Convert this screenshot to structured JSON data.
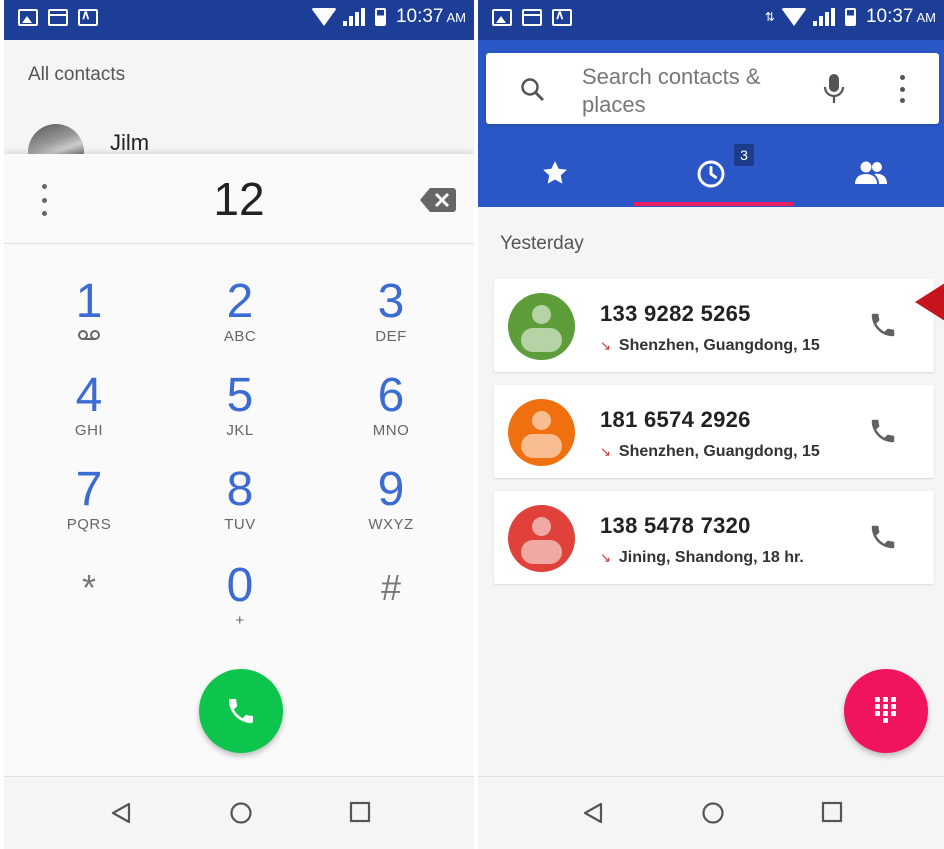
{
  "left_screen": {
    "status_bar": {
      "time": "10:37",
      "ampm": "AM"
    },
    "all_contacts_label": "All contacts",
    "contact_preview_name": "Jilm",
    "dialed_number": "12",
    "keys": [
      {
        "digit": "1",
        "letters": ""
      },
      {
        "digit": "2",
        "letters": "ABC"
      },
      {
        "digit": "3",
        "letters": "DEF"
      },
      {
        "digit": "4",
        "letters": "GHI"
      },
      {
        "digit": "5",
        "letters": "JKL"
      },
      {
        "digit": "6",
        "letters": "MNO"
      },
      {
        "digit": "7",
        "letters": "PQRS"
      },
      {
        "digit": "8",
        "letters": "TUV"
      },
      {
        "digit": "9",
        "letters": "WXYZ"
      },
      {
        "digit": "*",
        "letters": ""
      },
      {
        "digit": "0",
        "letters": "+"
      },
      {
        "digit": "#",
        "letters": ""
      }
    ]
  },
  "right_screen": {
    "status_bar": {
      "time": "10:37",
      "ampm": "AM"
    },
    "search": {
      "placeholder": "Search contacts & places"
    },
    "tabs": {
      "recents_badge": "3"
    },
    "section_title": "Yesterday",
    "calls": [
      {
        "number": "133 9282 5265",
        "location": "Shenzhen, Guangdong, 15",
        "avatar_color": "#5d9e3a"
      },
      {
        "number": "181 6574 2926",
        "location": "Shenzhen, Guangdong, 15",
        "avatar_color": "#f0700f"
      },
      {
        "number": "138 5478 7320",
        "location": "Jining, Shandong, 18 hr.",
        "avatar_color": "#e0413b"
      }
    ]
  },
  "colors": {
    "status_bar": "#1d3e96",
    "header_blue": "#2b57c6",
    "dial_digits": "#3d6bd4",
    "call_green": "#0dc54c",
    "fab_pink": "#f0135d",
    "tab_indicator": "#e91e63",
    "marker_red": "#c6131c"
  }
}
